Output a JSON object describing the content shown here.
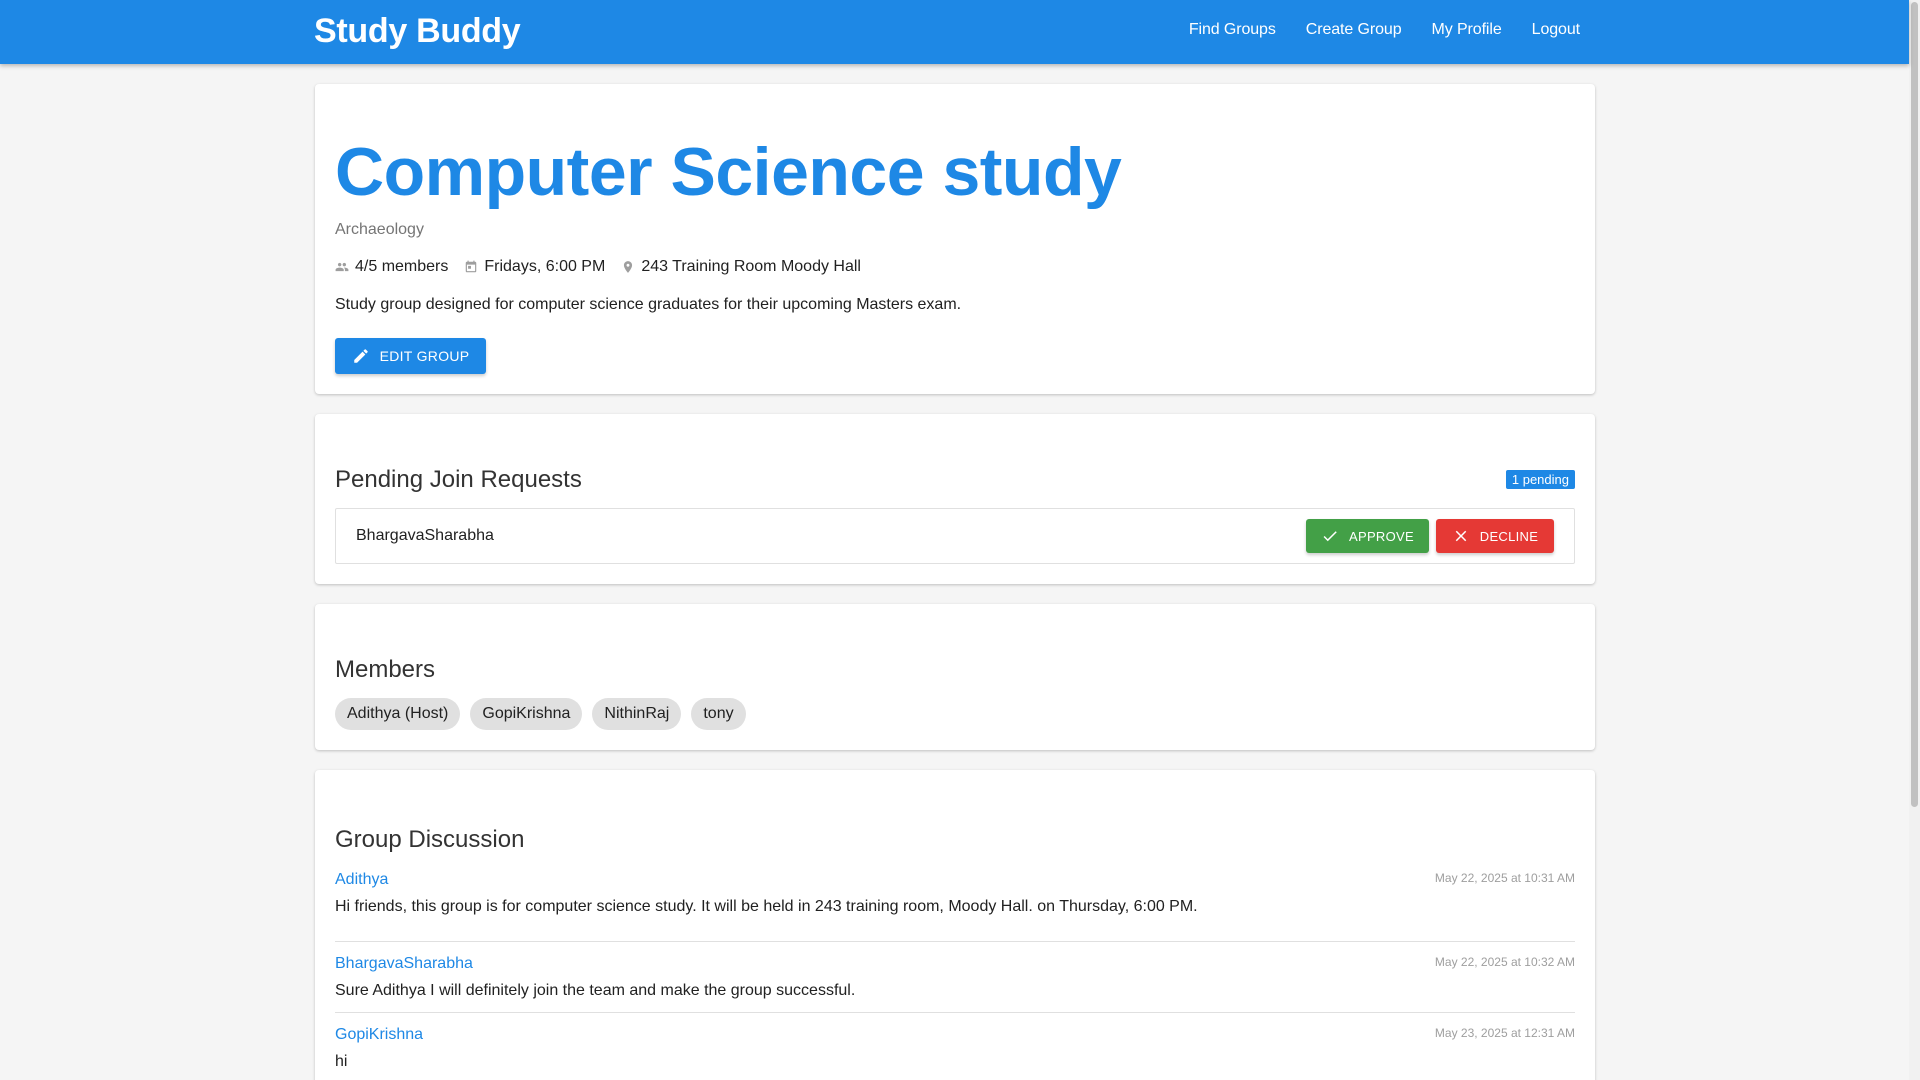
{
  "header": {
    "brand": "Study Buddy",
    "nav": [
      "Find Groups",
      "Create Group",
      "My Profile",
      "Logout"
    ]
  },
  "group": {
    "title": "Computer Science study",
    "subject": "Archaeology",
    "members_count": "4/5 members",
    "schedule": "Fridays, 6:00 PM",
    "location": "243 Training Room Moody Hall",
    "description": "Study group designed for computer science graduates for their upcoming Masters exam.",
    "edit_label": "EDIT GROUP"
  },
  "pending": {
    "title": "Pending Join Requests",
    "badge": "1 pending",
    "requests": [
      {
        "name": "BhargavaSharabha",
        "approve_label": "APPROVE",
        "decline_label": "DECLINE"
      }
    ]
  },
  "members": {
    "title": "Members",
    "list": [
      "Adithya (Host)",
      "GopiKrishna",
      "NithinRaj",
      "tony"
    ]
  },
  "discussion": {
    "title": "Group Discussion",
    "messages": [
      {
        "author": "Adithya",
        "time": "May 22, 2025 at 10:31 AM",
        "text": "Hi friends, this group is for computer science study. It will be held in 243 training room, Moody Hall. on Thursday, 6:00 PM."
      },
      {
        "author": "BhargavaSharabha",
        "time": "May 22, 2025 at 10:32 AM",
        "text": "Sure Adithya I will definitely join the team and make the group successful."
      },
      {
        "author": "GopiKrishna",
        "time": "May 23, 2025 at 12:31 AM",
        "text": "hi"
      }
    ]
  },
  "theme": {
    "primary": "#1e88e5",
    "approve": "#43a047",
    "decline": "#e53935",
    "chip": "#e0e0e0",
    "background": "#f5f5f5"
  },
  "icons": {
    "members": "people-icon",
    "schedule": "calendar-icon",
    "location": "pin-icon",
    "edit": "pencil-icon",
    "approve": "check-icon",
    "decline": "close-icon"
  }
}
